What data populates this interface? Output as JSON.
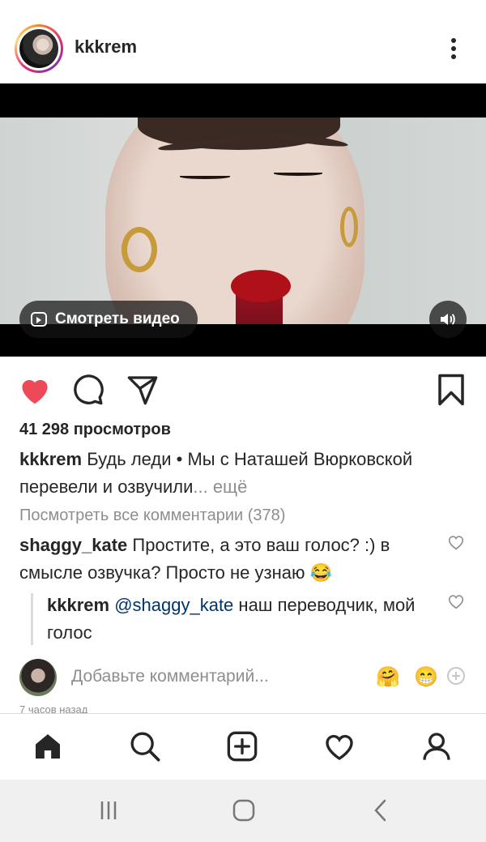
{
  "post": {
    "username": "kkkrem",
    "watch_video_label": "Смотреть видео",
    "views": "41 298 просмотров",
    "caption_user": "kkkrem",
    "caption_text": "Будь леди • Мы с Наташей Вюрковской перевели и озвучили",
    "caption_more": "... ещё",
    "view_all_comments": "Посмотреть все комментарии (378)",
    "comments": [
      {
        "user": "shaggy_kate",
        "text": "Простите, а это ваш голос? :) в смысле озвучка? Просто не узнаю 😂"
      }
    ],
    "reply": {
      "user": "kkkrem",
      "mention": "@shaggy_kate",
      "text": "наш переводчик, мой голос"
    },
    "add_comment_placeholder": "Добавьте комментарий...",
    "emoji_1": "🤗",
    "emoji_2": "😁",
    "timestamp": "7 часов назад"
  },
  "icons": {
    "like": "heart-filled-icon",
    "comment": "comment-icon",
    "share": "send-icon",
    "save": "bookmark-icon",
    "sound": "speaker-icon",
    "more": "more-vertical-icon"
  },
  "colors": {
    "like": "#ed4956",
    "mention": "#003569",
    "muted": "#8e8e8e"
  }
}
